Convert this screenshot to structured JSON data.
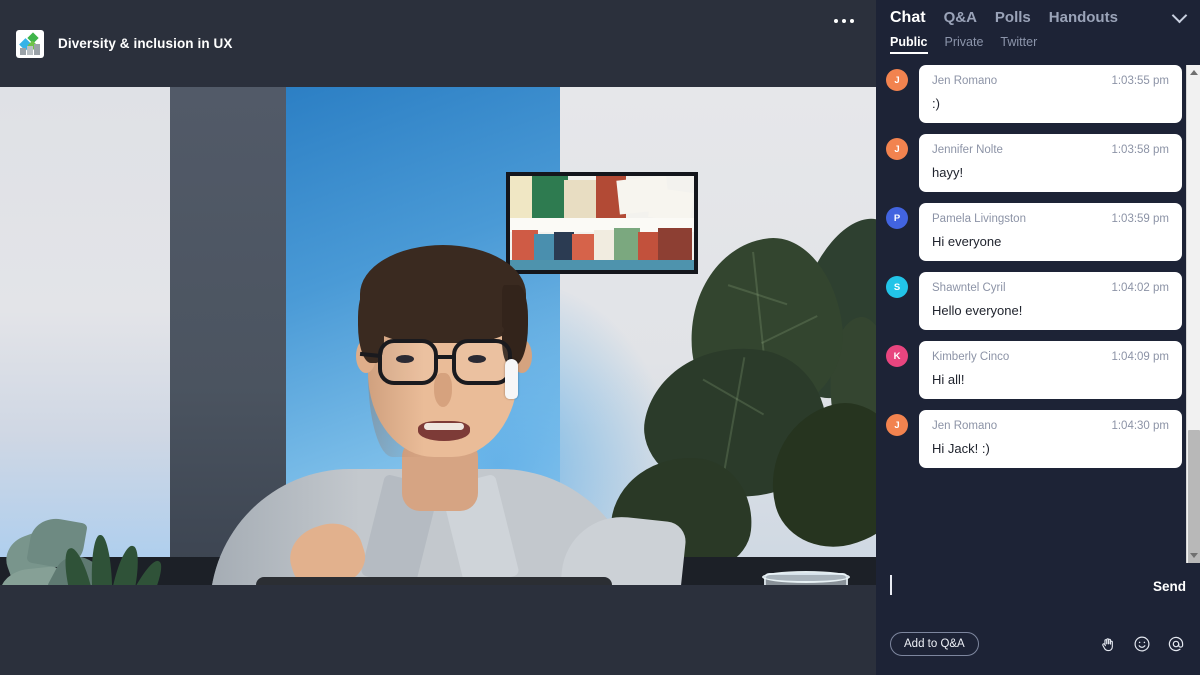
{
  "stage": {
    "logo_icon": "webinar-logo-icon",
    "title": "Diversity & inclusion in UX",
    "more_icon": "more-options-icon",
    "video": {
      "description": "Presenter speaking on webcam in a home office with a framed abstract artwork, fiddle-leaf fig plant, succulents in a yellow pot, a laptop and a glass of water"
    }
  },
  "panel": {
    "tabs": [
      {
        "label": "Chat",
        "active": true
      },
      {
        "label": "Q&A",
        "active": false
      },
      {
        "label": "Polls",
        "active": false
      },
      {
        "label": "Handouts",
        "active": false
      }
    ],
    "collapse_icon": "chevron-down-icon",
    "subtabs": [
      {
        "label": "Public",
        "active": true
      },
      {
        "label": "Private",
        "active": false
      },
      {
        "label": "Twitter",
        "active": false
      }
    ],
    "messages": [
      {
        "initial": "J",
        "color": "#f2834f",
        "name": "Jen Romano",
        "time": "1:03:55 pm",
        "text": ":)"
      },
      {
        "initial": "J",
        "color": "#f2834f",
        "name": "Jennifer Nolte",
        "time": "1:03:58 pm",
        "text": "hayy!"
      },
      {
        "initial": "P",
        "color": "#4264e0",
        "name": "Pamela Livingston",
        "time": "1:03:59 pm",
        "text": "Hi everyone"
      },
      {
        "initial": "S",
        "color": "#22c4e8",
        "name": "Shawntel Cyril",
        "time": "1:04:02 pm",
        "text": "Hello everyone!"
      },
      {
        "initial": "K",
        "color": "#e8457f",
        "name": "Kimberly Cinco",
        "time": "1:04:09 pm",
        "text": "Hi all!"
      },
      {
        "initial": "J",
        "color": "#f2834f",
        "name": "Jen Romano",
        "time": "1:04:30 pm",
        "text": "Hi Jack! :)"
      }
    ],
    "scrollbar": {
      "up_icon": "scroll-up-arrow-icon",
      "down_icon": "scroll-down-arrow-icon"
    },
    "composer": {
      "input_value": "",
      "input_placeholder": "",
      "send_label": "Send"
    },
    "actions": {
      "add_to_qa_label": "Add to Q&A",
      "icons": [
        {
          "name": "raise-hand-icon"
        },
        {
          "name": "emoji-smiley-icon"
        },
        {
          "name": "mention-at-icon"
        }
      ]
    }
  },
  "colors": {
    "panel_bg": "#1d2336",
    "stage_bg": "#2b303c",
    "bubble_bg": "#ffffff",
    "accent_text": "#ffffff"
  }
}
